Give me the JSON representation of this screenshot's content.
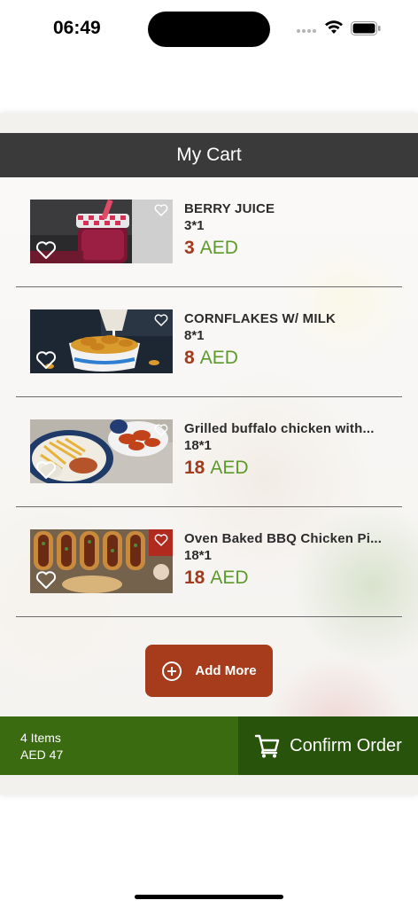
{
  "status_bar": {
    "time": "06:49"
  },
  "header": {
    "title": "My Cart"
  },
  "items": [
    {
      "name": "BERRY JUICE",
      "qty": "3*1",
      "price": "3",
      "currency": "AED",
      "image": "berry-juice-photo"
    },
    {
      "name": "CORNFLAKES W/ MILK",
      "qty": "8*1",
      "price": "8",
      "currency": "AED",
      "image": "cornflakes-photo"
    },
    {
      "name": "Grilled buffalo chicken with...",
      "qty": "18*1",
      "price": "18",
      "currency": "AED",
      "image": "buffalo-chicken-photo"
    },
    {
      "name": "Oven Baked BBQ Chicken Pi...",
      "qty": "18*1",
      "price": "18",
      "currency": "AED",
      "image": "bbq-chicken-photo"
    }
  ],
  "add_more": {
    "label": "Add More",
    "icon": "plus-circle-icon"
  },
  "summary": {
    "items": "4 Items",
    "total": "AED 47"
  },
  "confirm": {
    "label": "Confirm Order",
    "icon": "cart-icon"
  },
  "colors": {
    "header_bg": "#3a3a3a",
    "price_number": "#a33a1c",
    "price_currency": "#5c9a2a",
    "add_more_bg": "#a63c1b",
    "summary_bg": "#3b6b10",
    "confirm_bg": "#28530a"
  }
}
